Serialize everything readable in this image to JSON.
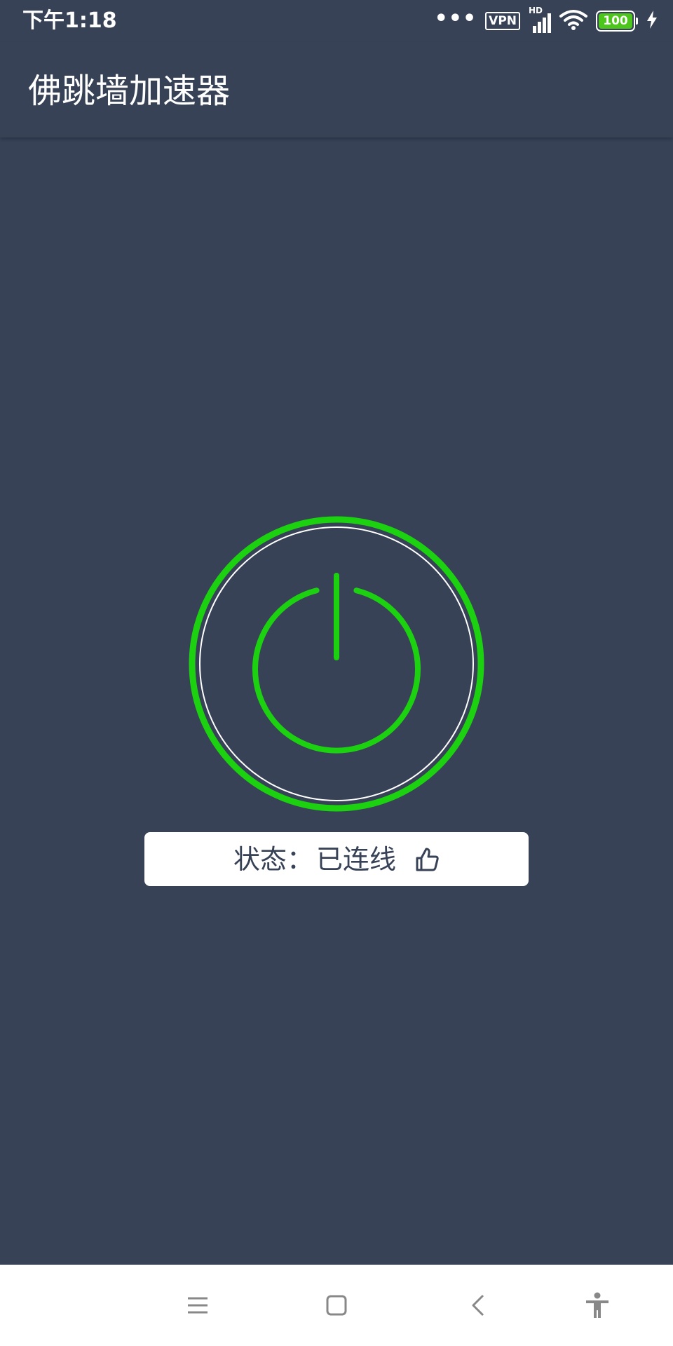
{
  "status_bar": {
    "time": "下午1:18",
    "dots": "•••",
    "vpn": "VPN",
    "hd": "HD",
    "battery": "100",
    "icons": [
      "more-dots-icon",
      "vpn-icon",
      "signal-icon",
      "wifi-icon",
      "battery-icon",
      "charging-icon"
    ]
  },
  "app_bar": {
    "title": "佛跳墙加速器"
  },
  "main": {
    "power_button_icon": "power-icon",
    "status_label": "状态：",
    "status_value": "已连线",
    "status_icon": "thumbs-up-icon"
  },
  "nav_bar": {
    "icons": [
      "menu-icon",
      "home-icon",
      "back-icon",
      "accessibility-icon"
    ]
  },
  "colors": {
    "background": "#374257",
    "accent_green": "#1cd10f",
    "status_box": "#ffffff",
    "nav_bar": "#ffffff"
  }
}
